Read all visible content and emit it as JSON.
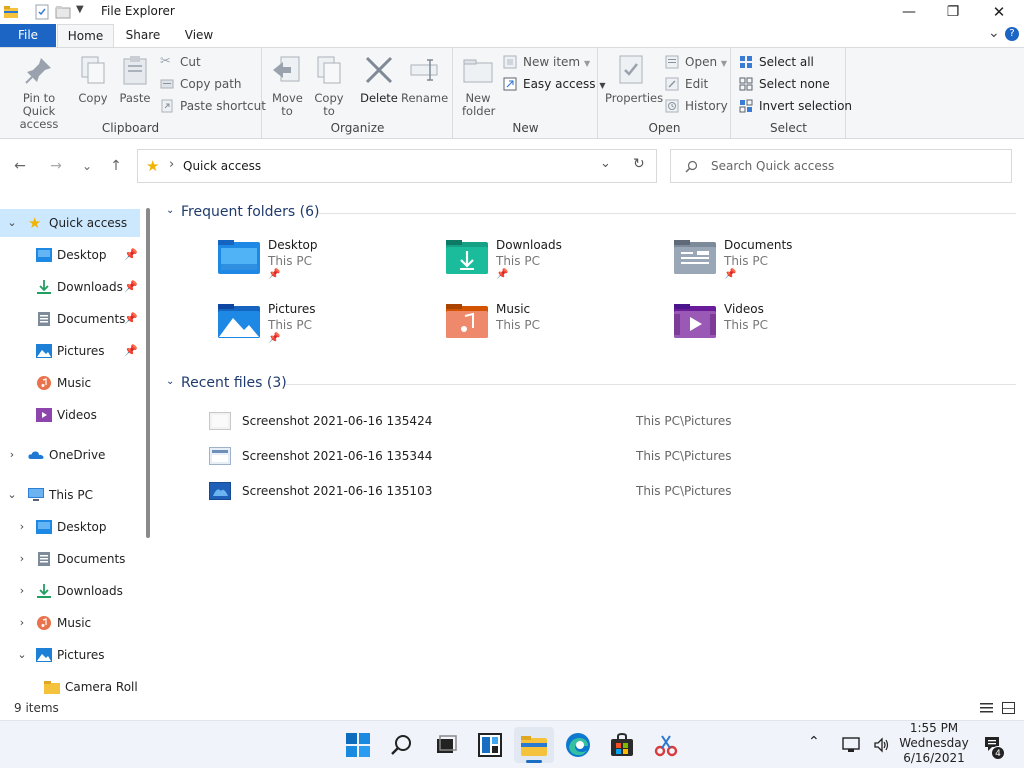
{
  "window": {
    "title": "File Explorer",
    "minimize_glyph": "—",
    "maximize_glyph": "❐",
    "close_glyph": "✕"
  },
  "ribbon_tabs": {
    "file": "File",
    "home": "Home",
    "share": "Share",
    "view": "View",
    "collapse_glyph": "⌄",
    "help_glyph": "?"
  },
  "ribbon": {
    "clipboard": {
      "label": "Clipboard",
      "pin": "Pin to Quick access",
      "copy": "Copy",
      "paste": "Paste",
      "cut": "Cut",
      "copy_path": "Copy path",
      "paste_shortcut": "Paste shortcut"
    },
    "organize": {
      "label": "Organize",
      "move_to": "Move to",
      "copy_to": "Copy to",
      "delete": "Delete",
      "rename": "Rename"
    },
    "new": {
      "label": "New",
      "new_folder": "New folder",
      "new_item": "New item",
      "easy_access": "Easy access"
    },
    "open": {
      "label": "Open",
      "properties": "Properties",
      "open": "Open",
      "edit": "Edit",
      "history": "History"
    },
    "select": {
      "label": "Select",
      "select_all": "Select all",
      "select_none": "Select none",
      "invert_selection": "Invert selection"
    }
  },
  "navigation": {
    "back_glyph": "←",
    "forward_glyph": "→",
    "recent_glyph": "⌄",
    "up_glyph": "↑",
    "address_text": "Quick access",
    "address_sep": "›",
    "dropdown_glyph": "⌄",
    "refresh_glyph": "↻",
    "search_placeholder": "Search Quick access"
  },
  "sidebar": {
    "quick_access": "Quick access",
    "pinned": [
      {
        "label": "Desktop",
        "pinned": true
      },
      {
        "label": "Downloads",
        "pinned": true
      },
      {
        "label": "Documents",
        "pinned": true
      },
      {
        "label": "Pictures",
        "pinned": true
      },
      {
        "label": "Music",
        "pinned": false
      },
      {
        "label": "Videos",
        "pinned": false
      }
    ],
    "onedrive": "OneDrive",
    "this_pc": "This PC",
    "this_pc_children": [
      "Desktop",
      "Documents",
      "Downloads",
      "Music",
      "Pictures"
    ],
    "camera_roll": "Camera Roll",
    "pin_glyph": "📌"
  },
  "content": {
    "frequent_title": "Frequent folders (6)",
    "recent_title": "Recent files (3)",
    "folders": [
      {
        "name": "Desktop",
        "location": "This PC",
        "pinned": true
      },
      {
        "name": "Downloads",
        "location": "This PC",
        "pinned": true
      },
      {
        "name": "Documents",
        "location": "This PC",
        "pinned": true
      },
      {
        "name": "Pictures",
        "location": "This PC",
        "pinned": true
      },
      {
        "name": "Music",
        "location": "This PC",
        "pinned": false
      },
      {
        "name": "Videos",
        "location": "This PC",
        "pinned": false
      }
    ],
    "files": [
      {
        "name": "Screenshot 2021-06-16 135424",
        "path": "This PC\\Pictures"
      },
      {
        "name": "Screenshot 2021-06-16 135344",
        "path": "This PC\\Pictures"
      },
      {
        "name": "Screenshot 2021-06-16 135103",
        "path": "This PC\\Pictures"
      }
    ]
  },
  "status": {
    "item_count": "9 items"
  },
  "taskbar": {
    "time": "1:55 PM",
    "day": "Wednesday",
    "date": "6/16/2021",
    "notification_count": "4"
  },
  "colors": {
    "accent": "#1c65c5",
    "selection": "#cce8ff",
    "section_header": "#1f3b6e"
  }
}
